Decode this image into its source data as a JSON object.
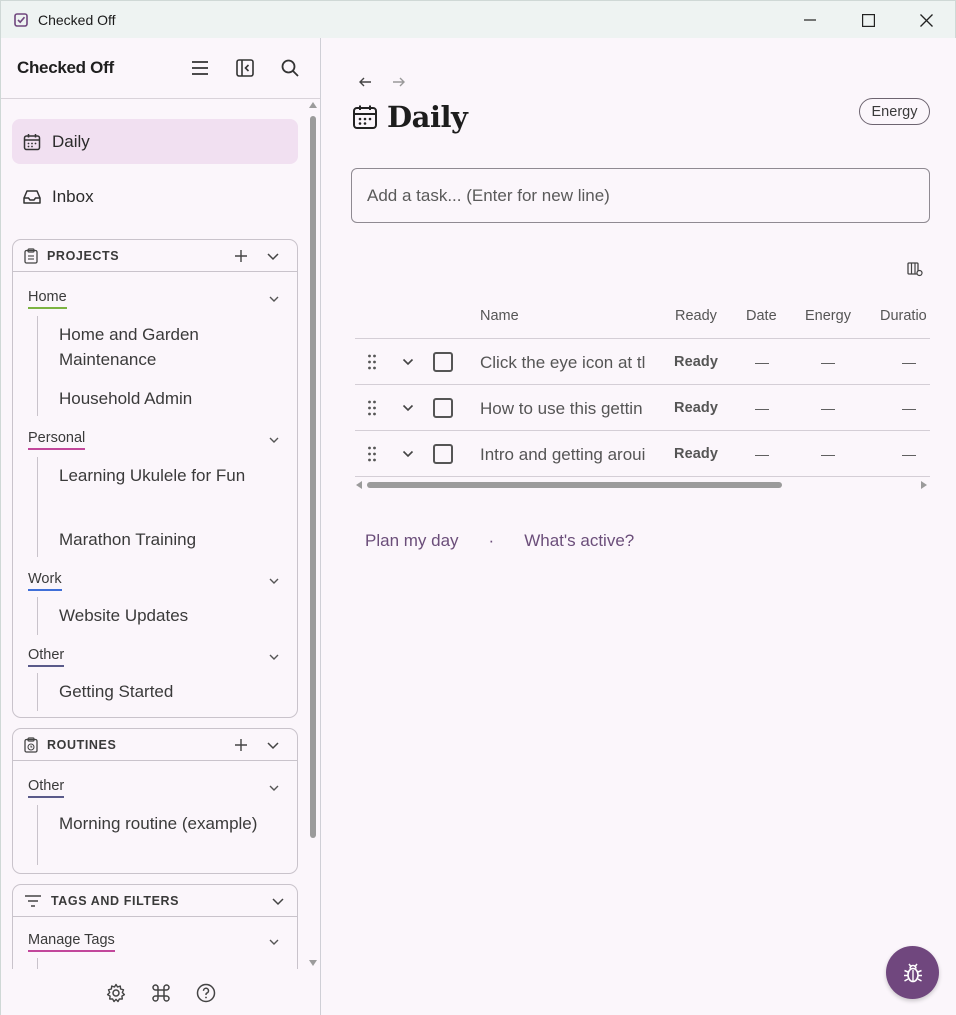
{
  "window": {
    "title": "Checked Off"
  },
  "sidebar": {
    "brand": "Checked Off",
    "nav": [
      {
        "label": "Daily",
        "icon": "calendar-icon",
        "active": true
      },
      {
        "label": "Inbox",
        "icon": "inbox-icon",
        "active": false
      }
    ],
    "projects": {
      "title": "PROJECTS",
      "groups": [
        {
          "name": "Home",
          "color": "#7cb342",
          "items": [
            "Home and Garden Maintenance",
            "Household Admin"
          ]
        },
        {
          "name": "Personal",
          "color": "#c2479b",
          "items": [
            "Learning Ukulele for Fun",
            "Marathon Training"
          ]
        },
        {
          "name": "Work",
          "color": "#3f6fd8",
          "items": [
            "Website Updates"
          ]
        },
        {
          "name": "Other",
          "color": "#5a5a8a",
          "items": [
            "Getting Started"
          ]
        }
      ]
    },
    "routines": {
      "title": "ROUTINES",
      "groups": [
        {
          "name": "Other",
          "color": "#5a5a8a",
          "items": [
            "Morning routine (example)"
          ]
        }
      ]
    },
    "tags": {
      "title": "TAGS AND FILTERS",
      "groups": [
        {
          "name": "Manage Tags",
          "color": "#c2479b"
        }
      ]
    },
    "footer_icons": [
      "settings-icon",
      "command-icon",
      "help-icon"
    ]
  },
  "main": {
    "title": "Daily",
    "energy_button": "Energy",
    "task_input_placeholder": "Add a task... (Enter for new line)",
    "table": {
      "columns": [
        "Name",
        "Ready",
        "Date",
        "Energy",
        "Duratio"
      ],
      "rows": [
        {
          "name": "Click the eye icon at tl",
          "ready": "Ready",
          "date": "—",
          "energy": "—",
          "duration": "—"
        },
        {
          "name": "How to use this gettin",
          "ready": "Ready",
          "date": "—",
          "energy": "—",
          "duration": "—"
        },
        {
          "name": "Intro and getting aroui",
          "ready": "Ready",
          "date": "—",
          "energy": "—",
          "duration": "—"
        }
      ]
    },
    "links": {
      "plan": "Plan my day",
      "separator": "·",
      "active": "What's active?"
    }
  },
  "colors": {
    "accent": "#70477e",
    "active_nav_bg": "#f1e0f1",
    "link": "#6b4e7a"
  }
}
